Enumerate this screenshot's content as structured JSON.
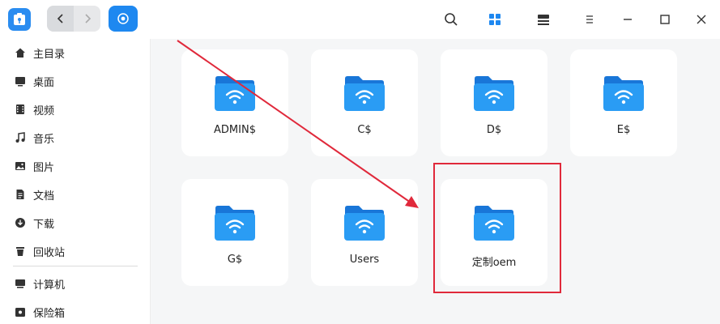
{
  "sidebar": {
    "items": [
      {
        "label": "主目录",
        "icon": "home-icon"
      },
      {
        "label": "桌面",
        "icon": "desktop-icon"
      },
      {
        "label": "视频",
        "icon": "video-icon"
      },
      {
        "label": "音乐",
        "icon": "music-icon"
      },
      {
        "label": "图片",
        "icon": "picture-icon"
      },
      {
        "label": "文档",
        "icon": "document-icon"
      },
      {
        "label": "下载",
        "icon": "download-icon"
      },
      {
        "label": "回收站",
        "icon": "trash-icon"
      },
      {
        "label": "计算机",
        "icon": "computer-icon"
      },
      {
        "label": "保险箱",
        "icon": "safe-icon"
      }
    ]
  },
  "folders": [
    {
      "name": "ADMIN$"
    },
    {
      "name": "C$"
    },
    {
      "name": "D$"
    },
    {
      "name": "E$"
    },
    {
      "name": "G$"
    },
    {
      "name": "Users"
    },
    {
      "name": "定制oem"
    }
  ],
  "colors": {
    "accent": "#1e88f0",
    "folder": "#2a9cf4",
    "annotation": "#e0293b"
  }
}
